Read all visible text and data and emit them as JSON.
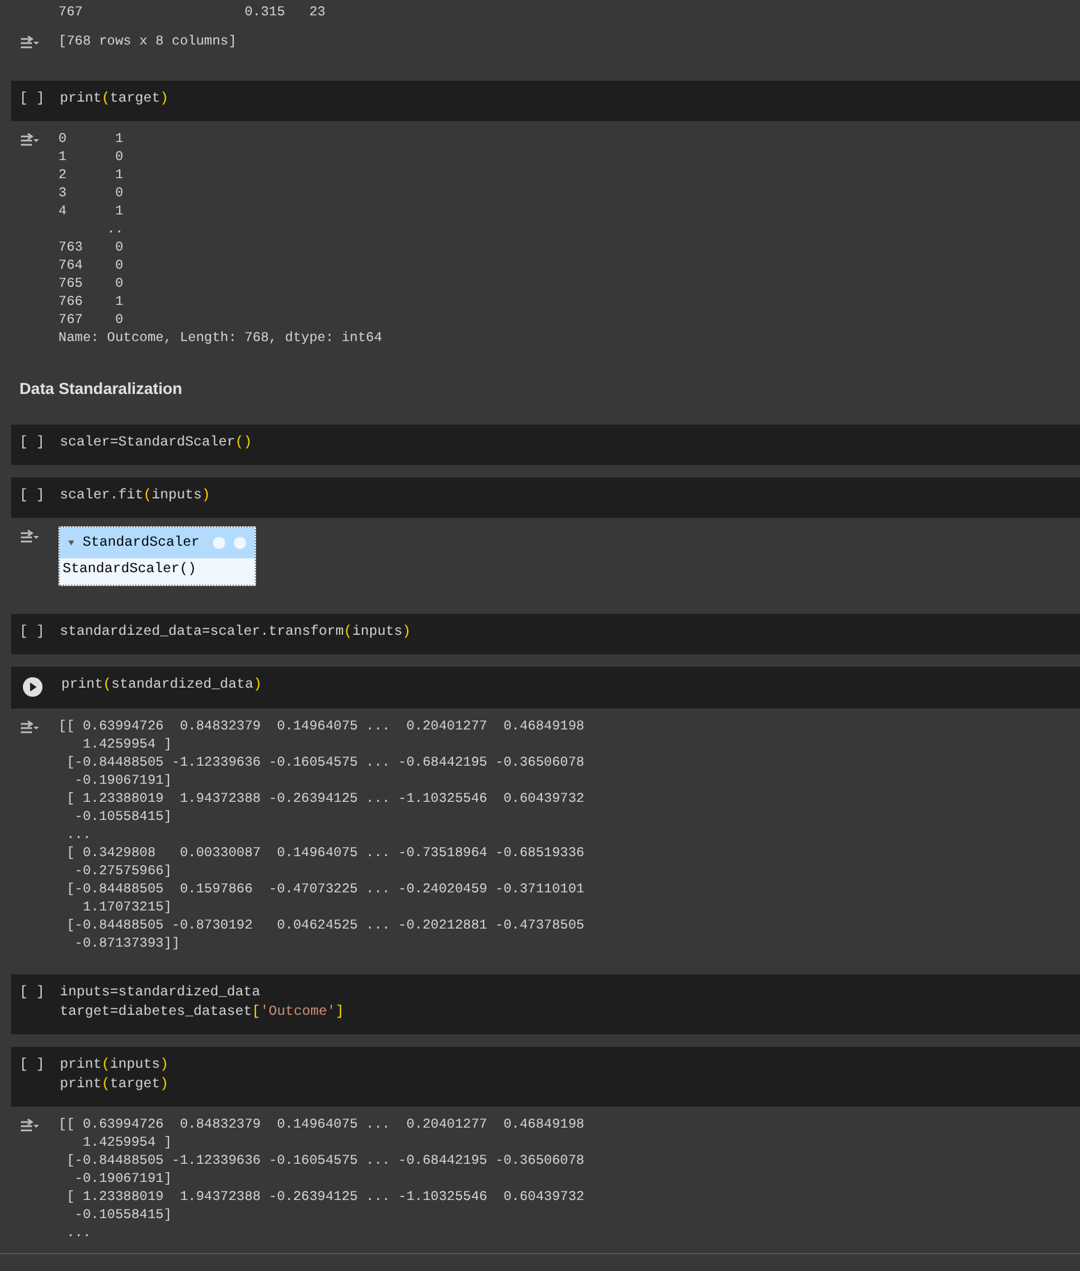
{
  "blocks": [
    {
      "kind": "output",
      "icon": false,
      "lines": [
        "767                    0.315   23"
      ]
    },
    {
      "kind": "output",
      "icon": true,
      "lines": [
        "[768 rows x 8 columns]"
      ]
    },
    {
      "kind": "code",
      "run_button": false,
      "prompt": "[ ]",
      "lines": [
        "print(target)"
      ]
    },
    {
      "kind": "output",
      "icon": true,
      "lines": [
        "0      1",
        "1      0",
        "2      1",
        "3      0",
        "4      1",
        "      ..",
        "763    0",
        "764    0",
        "765    0",
        "766    1",
        "767    0",
        "Name: Outcome, Length: 768, dtype: int64"
      ]
    },
    {
      "kind": "markdown",
      "text": "Data Standaralization"
    },
    {
      "kind": "code",
      "run_button": false,
      "prompt": "[ ]",
      "lines": [
        "scaler=StandardScaler()"
      ]
    },
    {
      "kind": "code",
      "run_button": false,
      "prompt": "[ ]",
      "lines": [
        "scaler.fit(inputs)"
      ]
    },
    {
      "kind": "widget",
      "icon": true,
      "title": "StandardScaler",
      "body": "StandardScaler()"
    },
    {
      "kind": "code",
      "run_button": false,
      "prompt": "[ ]",
      "lines": [
        "standardized_data=scaler.transform(inputs)"
      ]
    },
    {
      "kind": "code",
      "run_button": true,
      "lines": [
        "print(standardized_data)"
      ]
    },
    {
      "kind": "output",
      "icon": true,
      "lines": [
        "[[ 0.63994726  0.84832379  0.14964075 ...  0.20401277  0.46849198",
        "   1.4259954 ]",
        " [-0.84488505 -1.12339636 -0.16054575 ... -0.68442195 -0.36506078",
        "  -0.19067191]",
        " [ 1.23388019  1.94372388 -0.26394125 ... -1.10325546  0.60439732",
        "  -0.10558415]",
        " ...",
        " [ 0.3429808   0.00330087  0.14964075 ... -0.73518964 -0.68519336",
        "  -0.27575966]",
        " [-0.84488505  0.1597866  -0.47073225 ... -0.24020459 -0.37110101",
        "   1.17073215]",
        " [-0.84488505 -0.8730192   0.04624525 ... -0.20212881 -0.47378505",
        "  -0.87137393]]"
      ]
    },
    {
      "kind": "code",
      "run_button": false,
      "prompt": "[ ]",
      "lines": [
        "inputs=standardized_data",
        "target=diabetes_dataset['Outcome']"
      ]
    },
    {
      "kind": "code",
      "run_button": false,
      "prompt": "[ ]",
      "lines": [
        "print(inputs)",
        "print(target)"
      ]
    },
    {
      "kind": "output",
      "icon": true,
      "lines": [
        "[[ 0.63994726  0.84832379  0.14964075 ...  0.20401277  0.46849198",
        "   1.4259954 ]",
        " [-0.84488505 -1.12339636 -0.16054575 ... -0.68442195 -0.36506078",
        "  -0.19067191]",
        " [ 1.23388019  1.94372388 -0.26394125 ... -1.10325546  0.60439732",
        "  -0.10558415]",
        " ..."
      ]
    }
  ]
}
